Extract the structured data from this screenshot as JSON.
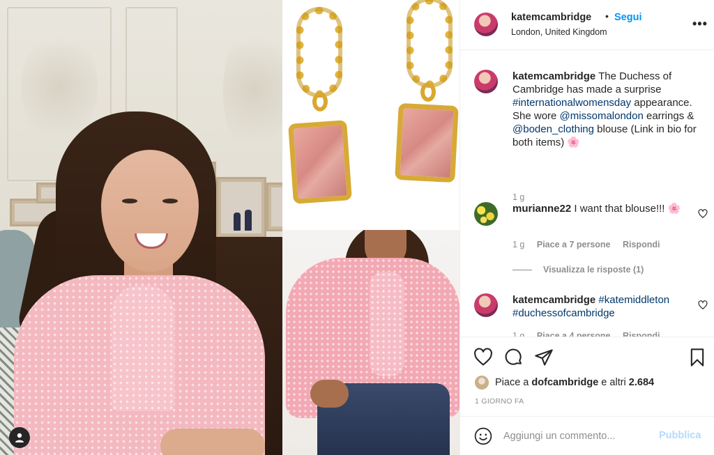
{
  "post": {
    "username": "katemcambridge",
    "separator": "•",
    "follow_label": "Segui",
    "location": "London, United Kingdom",
    "more_label": "•••"
  },
  "caption": {
    "username": "katemcambridge",
    "text_1": " The Duchess of Cambridge has made a surprise ",
    "hashtag": "#internationalwomensday",
    "text_2": " appearance. She wore ",
    "mention_1": "@missomalondon",
    "text_3": " earrings & ",
    "mention_2": "@boden_clothing",
    "text_4": " blouse (Link in bio for both items) ",
    "emoji": "🌸",
    "time": "1 g"
  },
  "comments": [
    {
      "username": "murianne22",
      "text": " I want that blouse!!! ",
      "emoji": "🌸",
      "time": "1 g",
      "likes": "Piace a 7 persone",
      "reply": "Rispondi",
      "view_replies": "Visualizza le risposte (1)"
    },
    {
      "username": "katemcambridge",
      "hashtag_1": "#katemiddleton",
      "hashtag_2": "#duchessofcambridge",
      "time": "1 g",
      "likes": "Piace a 4 persone",
      "reply": "Rispondi"
    }
  ],
  "actions": {
    "icons": [
      "heart-icon",
      "comment-icon",
      "share-icon",
      "bookmark-icon"
    ],
    "likes_prefix": "Piace a ",
    "likes_user": "dofcambridge",
    "likes_middle": " e altri ",
    "likes_count": "2.684",
    "time_ago": "1 GIORNO FA"
  },
  "add_comment": {
    "placeholder": "Aggiungi un commento...",
    "publish_label": "Pubblica"
  },
  "colors": {
    "link_blue": "#0095f6",
    "hashtag_navy": "#00376b",
    "publish_disabled": "#b3dbff",
    "muted_gray": "#8e8e8e"
  }
}
